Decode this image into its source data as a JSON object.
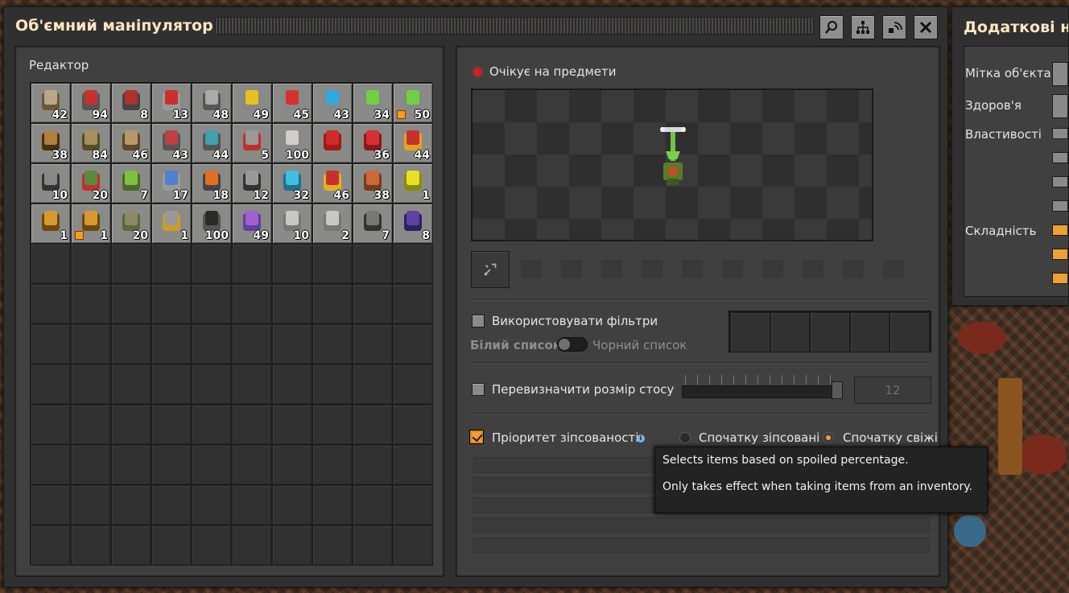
{
  "window": {
    "title": "Об'ємний маніпулятор",
    "buttons": [
      "search-icon",
      "network-icon",
      "signal-icon",
      "close-icon"
    ]
  },
  "editor": {
    "label": "Редактор",
    "slots": [
      {
        "icon": "pump",
        "count": "42"
      },
      {
        "icon": "transport-belt",
        "count": "94"
      },
      {
        "icon": "underground-belt",
        "count": "8"
      },
      {
        "icon": "splitter",
        "count": "13"
      },
      {
        "icon": "loader",
        "count": "48"
      },
      {
        "icon": "inserter-yellow",
        "count": "49"
      },
      {
        "icon": "inserter-red",
        "count": "45"
      },
      {
        "icon": "inserter-blue",
        "count": "43"
      },
      {
        "icon": "inserter-green",
        "count": "34"
      },
      {
        "icon": "inserter-green",
        "count": "50",
        "quality": true
      },
      {
        "icon": "power-pole",
        "count": "38"
      },
      {
        "icon": "pipe",
        "count": "84"
      },
      {
        "icon": "pipe-elbow",
        "count": "46"
      },
      {
        "icon": "assembler-red",
        "count": "43"
      },
      {
        "icon": "assembler-blue",
        "count": "44"
      },
      {
        "icon": "chemical-plant",
        "count": "5"
      },
      {
        "icon": "stone-brick",
        "count": "100"
      },
      {
        "icon": "red-tile",
        "count": ""
      },
      {
        "icon": "red-pipe",
        "count": "36"
      },
      {
        "icon": "furnace-red",
        "count": "44"
      },
      {
        "icon": "wheel",
        "count": "10"
      },
      {
        "icon": "pipeline",
        "count": "20"
      },
      {
        "icon": "green-tank",
        "count": "7"
      },
      {
        "icon": "robot",
        "count": "17"
      },
      {
        "icon": "fire-tower",
        "count": "18"
      },
      {
        "icon": "spider",
        "count": "12"
      },
      {
        "icon": "blue-orbs",
        "count": "32"
      },
      {
        "icon": "red-crate",
        "count": "46"
      },
      {
        "icon": "copper-ore",
        "count": "38"
      },
      {
        "icon": "yellow-crystal",
        "count": "1"
      },
      {
        "icon": "barrel",
        "count": "1"
      },
      {
        "icon": "barrel",
        "count": "1",
        "quality": true
      },
      {
        "icon": "rock",
        "count": "20"
      },
      {
        "icon": "drill",
        "count": "1"
      },
      {
        "icon": "carbon-pile",
        "count": "100"
      },
      {
        "icon": "electric-box",
        "count": "49"
      },
      {
        "icon": "steel-plate",
        "count": "10"
      },
      {
        "icon": "steel-plate",
        "count": "2"
      },
      {
        "icon": "iron-chest",
        "count": "7"
      },
      {
        "icon": "purple-pipe",
        "count": "8"
      }
    ]
  },
  "status": {
    "text": "Очікує на предмети",
    "color": "#e01b1b"
  },
  "filters": {
    "use_label": "Використовувати фільтри",
    "whitelist": "Білий список",
    "blacklist": "Чорний список"
  },
  "stack": {
    "label": "Перевизначити розмір стосу",
    "value": "12",
    "slider_fraction": 1
  },
  "spoil": {
    "label": "Пріоритет зіпсованості",
    "option_spoiled": "Спочатку зіпсовані",
    "option_fresh": "Спочатку свіжі",
    "selected": "fresh",
    "checked": true
  },
  "tooltip": {
    "line1": "Selects items based on spoiled percentage.",
    "line2": "Only takes effect when taking items from an inventory."
  },
  "side": {
    "title": "Додаткові на",
    "entity_label": "Мітка об'єкта",
    "health": "Здоров'я",
    "properties": "Властивості",
    "difficulty": "Складність"
  },
  "colors": {
    "accent": "#f0a033",
    "title": "#ffe6c0"
  }
}
